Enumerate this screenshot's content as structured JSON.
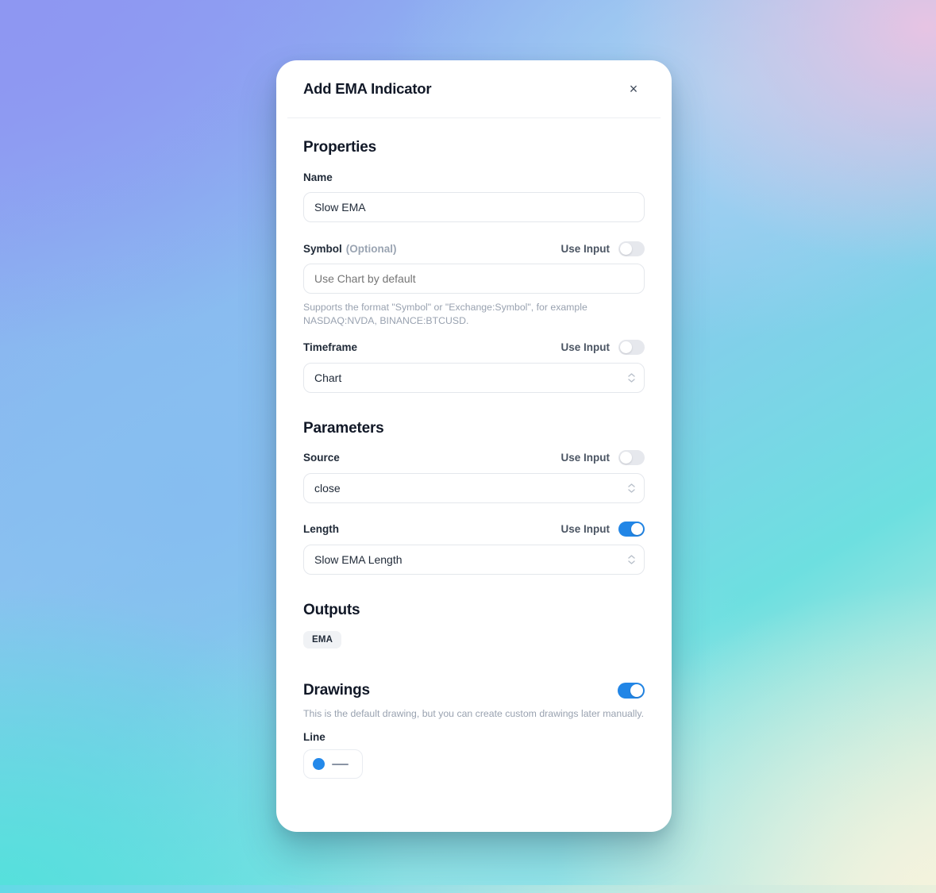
{
  "dialog": {
    "title": "Add EMA Indicator",
    "close_icon_label": "×"
  },
  "sections": {
    "properties": {
      "heading": "Properties",
      "name": {
        "label": "Name",
        "value": "Slow EMA"
      },
      "symbol": {
        "label": "Symbol",
        "optional_label": "(Optional)",
        "use_input_label": "Use Input",
        "use_input_on": false,
        "placeholder": "Use Chart by default",
        "value": "",
        "help_text": "Supports the format \"Symbol\" or \"Exchange:Symbol\", for example NASDAQ:NVDA, BINANCE:BTCUSD."
      },
      "timeframe": {
        "label": "Timeframe",
        "use_input_label": "Use Input",
        "use_input_on": false,
        "value": "Chart"
      }
    },
    "parameters": {
      "heading": "Parameters",
      "source": {
        "label": "Source",
        "use_input_label": "Use Input",
        "use_input_on": false,
        "value": "close"
      },
      "length": {
        "label": "Length",
        "use_input_label": "Use Input",
        "use_input_on": true,
        "value": "Slow EMA Length"
      }
    },
    "outputs": {
      "heading": "Outputs",
      "badges": [
        "EMA"
      ]
    },
    "drawings": {
      "heading": "Drawings",
      "enabled": true,
      "help_text": "This is the default drawing, but you can create custom drawings later manually.",
      "line": {
        "label": "Line",
        "color": "#2489ea",
        "stroke_color": "#8a94a4"
      }
    }
  },
  "theme": {
    "accent": "#2286e6",
    "card_bg": "#ffffff",
    "text_primary": "#111827",
    "text_muted": "#99a2b0",
    "border": "#e4e7ec",
    "badge_bg": "#f0f2f5"
  }
}
